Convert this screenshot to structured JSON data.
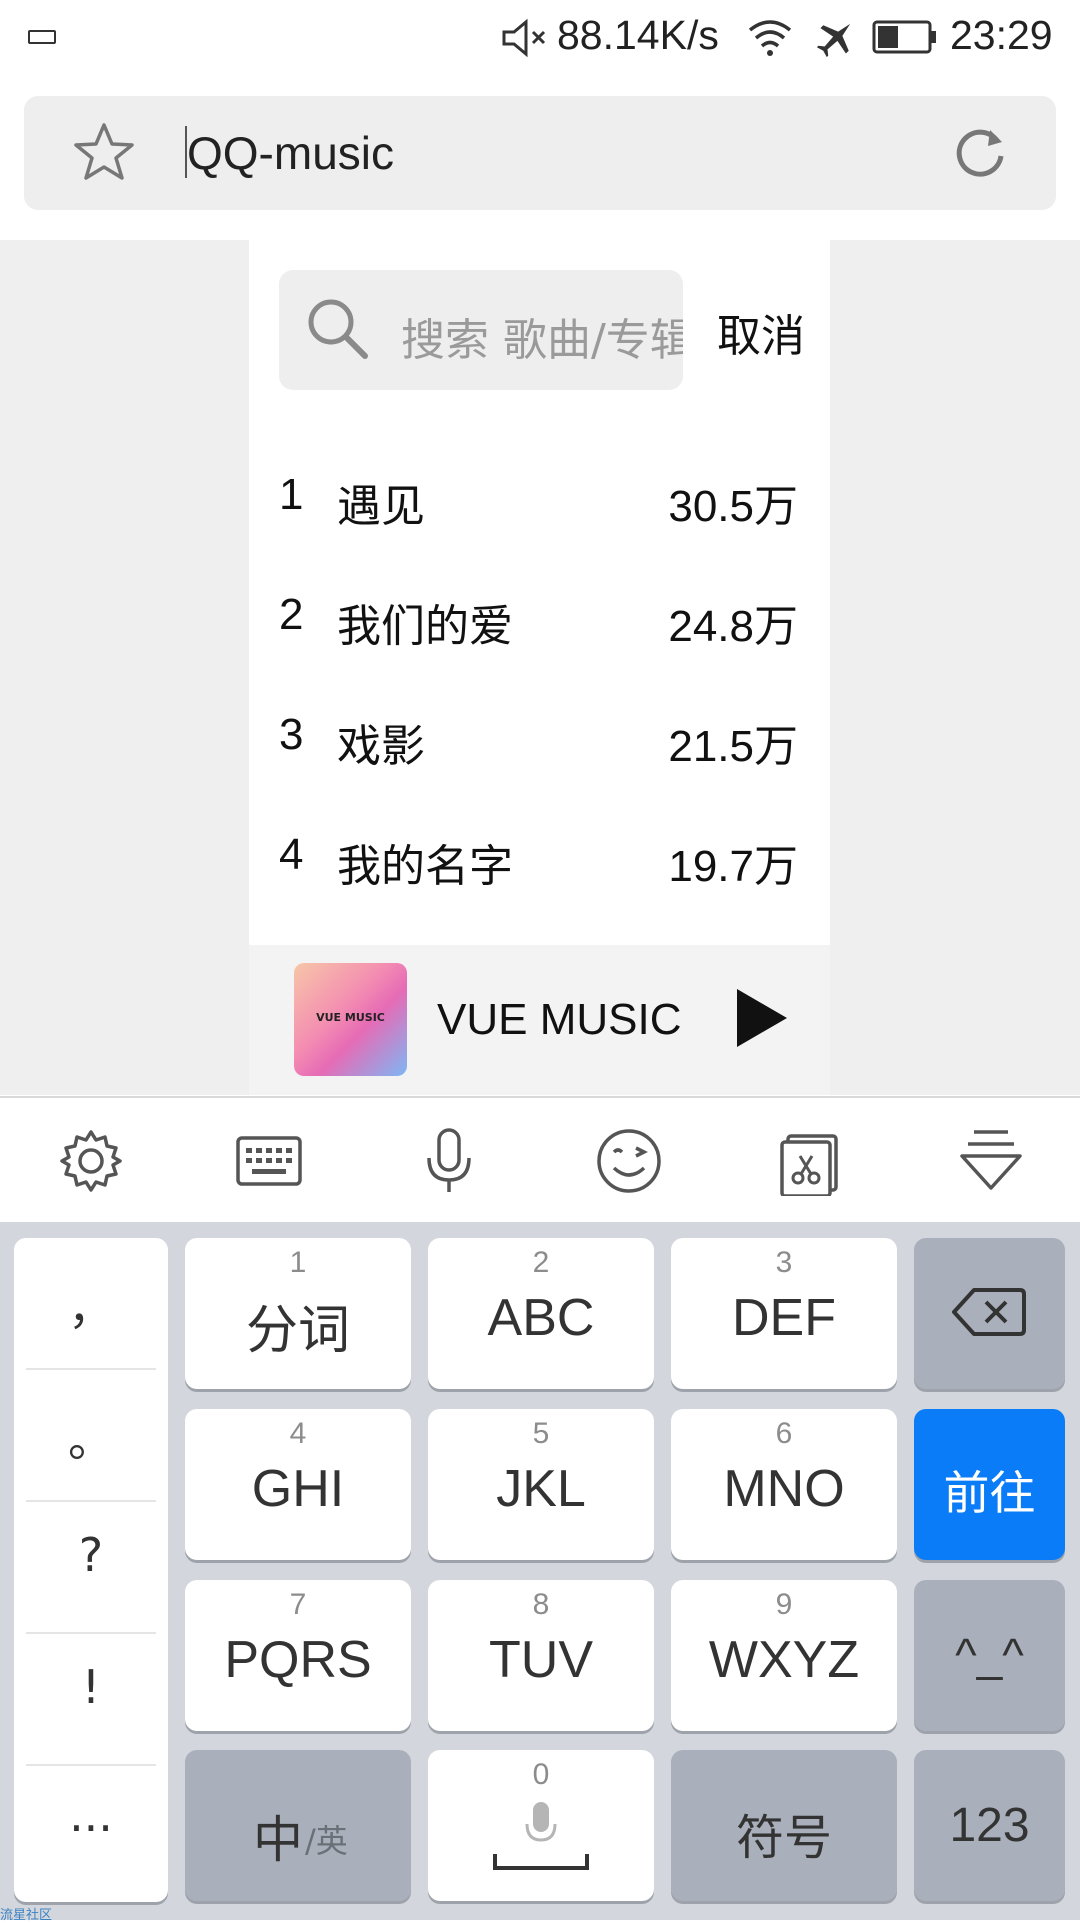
{
  "status_bar": {
    "net_speed": "88.14K/s",
    "time": "23:29",
    "icons": [
      "keyboard-icon",
      "mute-icon",
      "wifi-icon",
      "airplane-icon",
      "battery-icon"
    ]
  },
  "address_bar": {
    "url_text": "QQ-music",
    "icons": [
      "star-icon",
      "refresh-icon"
    ]
  },
  "search": {
    "placeholder": "搜索 歌曲/专辑",
    "cancel_label": "取消"
  },
  "hot_list": [
    {
      "rank": "1",
      "title": "遇见",
      "count": "30.5万"
    },
    {
      "rank": "2",
      "title": "我们的爱",
      "count": "24.8万"
    },
    {
      "rank": "3",
      "title": "戏影",
      "count": "21.5万"
    },
    {
      "rank": "4",
      "title": "我的名字",
      "count": "19.7万"
    }
  ],
  "mini_player": {
    "cover_label": "VUE MUSIC",
    "title": "VUE MUSIC"
  },
  "keyboard_toolbar": [
    "settings-icon",
    "keyboard-switch-icon",
    "microphone-icon",
    "emoji-icon",
    "clipboard-icon",
    "hide-keyboard-icon"
  ],
  "keyboard": {
    "punctuation": [
      "，",
      "。",
      "?",
      "!",
      "..."
    ],
    "keys": [
      {
        "num": "1",
        "label": "分词"
      },
      {
        "num": "2",
        "label": "ABC"
      },
      {
        "num": "3",
        "label": "DEF"
      },
      {
        "num": "4",
        "label": "GHI"
      },
      {
        "num": "5",
        "label": "JKL"
      },
      {
        "num": "6",
        "label": "MNO"
      },
      {
        "num": "7",
        "label": "PQRS"
      },
      {
        "num": "8",
        "label": "TUV"
      },
      {
        "num": "9",
        "label": "WXYZ"
      }
    ],
    "go_label": "前往",
    "emoticon_label": "^_^",
    "lang_main": "中",
    "lang_sub": "/英",
    "space_num": "0",
    "symbol_label": "符号",
    "numeric_label": "123"
  },
  "colors": {
    "accent_blue": "#0a7cf7",
    "key_dark": "#aab0bb",
    "keyboard_bg": "#d3d6dc"
  },
  "watermark": "流星社区"
}
